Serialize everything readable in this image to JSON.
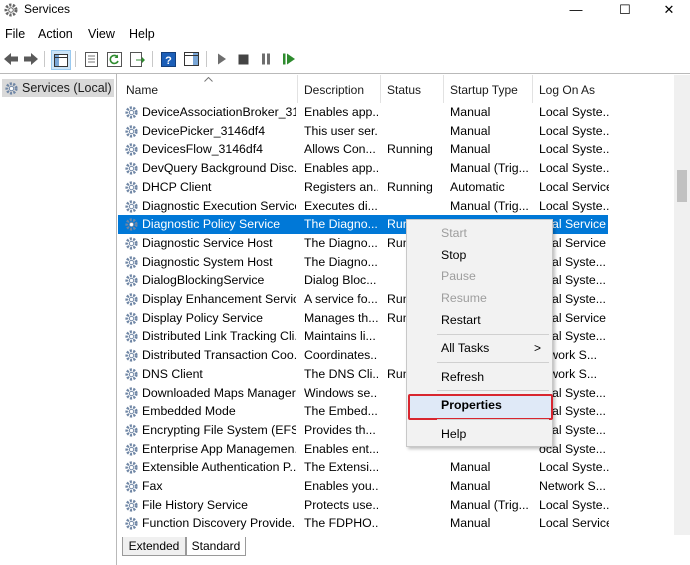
{
  "window": {
    "title": "Services"
  },
  "menu": [
    "File",
    "Action",
    "View",
    "Help"
  ],
  "tree": {
    "label": "Services (Local)"
  },
  "columns": [
    "Name",
    "Description",
    "Status",
    "Startup Type",
    "Log On As"
  ],
  "rows": [
    {
      "name": "DeviceAssociationBroker_31...",
      "desc": "Enables app...",
      "status": "",
      "startup": "Manual",
      "logon": "Local Syste..."
    },
    {
      "name": "DevicePicker_3146df4",
      "desc": "This user ser...",
      "status": "",
      "startup": "Manual",
      "logon": "Local Syste..."
    },
    {
      "name": "DevicesFlow_3146df4",
      "desc": "Allows Con...",
      "status": "Running",
      "startup": "Manual",
      "logon": "Local Syste..."
    },
    {
      "name": "DevQuery Background Disc...",
      "desc": "Enables app...",
      "status": "",
      "startup": "Manual (Trig...",
      "logon": "Local Syste..."
    },
    {
      "name": "DHCP Client",
      "desc": "Registers an...",
      "status": "Running",
      "startup": "Automatic",
      "logon": "Local Service"
    },
    {
      "name": "Diagnostic Execution Service",
      "desc": "Executes di...",
      "status": "",
      "startup": "Manual (Trig...",
      "logon": "Local Syste..."
    },
    {
      "name": "Diagnostic Policy Service",
      "desc": "The Diagno...",
      "status": "Run",
      "startup": "",
      "logon": "ocal Service"
    },
    {
      "name": "Diagnostic Service Host",
      "desc": "The Diagno...",
      "status": "Run",
      "startup": "",
      "logon": "ocal Service"
    },
    {
      "name": "Diagnostic System Host",
      "desc": "The Diagno...",
      "status": "",
      "startup": "",
      "logon": "ocal Syste..."
    },
    {
      "name": "DialogBlockingService",
      "desc": "Dialog Bloc...",
      "status": "",
      "startup": "",
      "logon": "ocal Syste..."
    },
    {
      "name": "Display Enhancement Service",
      "desc": "A service fo...",
      "status": "Run",
      "startup": "",
      "logon": "ocal Syste..."
    },
    {
      "name": "Display Policy Service",
      "desc": "Manages th...",
      "status": "Run",
      "startup": "",
      "logon": "ocal Service"
    },
    {
      "name": "Distributed Link Tracking Cli...",
      "desc": "Maintains li...",
      "status": "",
      "startup": "",
      "logon": "ocal Syste..."
    },
    {
      "name": "Distributed Transaction Coo...",
      "desc": "Coordinates...",
      "status": "",
      "startup": "",
      "logon": "etwork S..."
    },
    {
      "name": "DNS Client",
      "desc": "The DNS Cli...",
      "status": "Run",
      "startup": "",
      "logon": "etwork S..."
    },
    {
      "name": "Downloaded Maps Manager",
      "desc": "Windows se...",
      "status": "",
      "startup": "",
      "logon": "ocal Syste..."
    },
    {
      "name": "Embedded Mode",
      "desc": "The Embed...",
      "status": "",
      "startup": "",
      "logon": "ocal Syste..."
    },
    {
      "name": "Encrypting File System (EFS)",
      "desc": "Provides th...",
      "status": "",
      "startup": "",
      "logon": "ocal Syste..."
    },
    {
      "name": "Enterprise App Managemen...",
      "desc": "Enables ent...",
      "status": "",
      "startup": "",
      "logon": "ocal Syste..."
    },
    {
      "name": "Extensible Authentication P...",
      "desc": "The Extensi...",
      "status": "",
      "startup": "Manual",
      "logon": "Local Syste..."
    },
    {
      "name": "Fax",
      "desc": "Enables you...",
      "status": "",
      "startup": "Manual",
      "logon": "Network S..."
    },
    {
      "name": "File History Service",
      "desc": "Protects use...",
      "status": "",
      "startup": "Manual (Trig...",
      "logon": "Local Syste..."
    },
    {
      "name": "Function Discovery Provide...",
      "desc": "The FDPHO...",
      "status": "",
      "startup": "Manual",
      "logon": "Local Service"
    }
  ],
  "context_menu": [
    {
      "label": "Start",
      "disabled": true
    },
    {
      "label": "Stop",
      "disabled": false
    },
    {
      "label": "Pause",
      "disabled": true
    },
    {
      "label": "Resume",
      "disabled": true
    },
    {
      "label": "Restart",
      "disabled": false
    },
    {
      "label": "All Tasks",
      "disabled": false,
      "submenu_arrow": ">"
    },
    {
      "label": "Refresh",
      "disabled": false
    },
    {
      "label": "Properties",
      "disabled": false
    },
    {
      "label": "Help",
      "disabled": false
    }
  ],
  "tabs": [
    "Extended",
    "Standard"
  ],
  "colors": {
    "selection": "#0078d7",
    "highlight_border": "#d8262f"
  }
}
